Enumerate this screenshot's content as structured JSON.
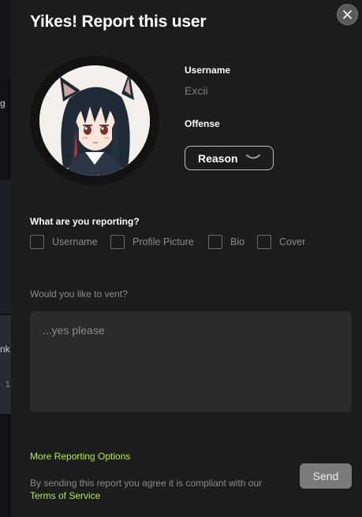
{
  "background": {
    "fragments": [
      "g",
      "nk",
      "· 1"
    ]
  },
  "modal": {
    "title": "Yikes! Report this user",
    "close_icon": "close-icon",
    "avatar_icon": "avatar-anime-cat-girl",
    "username_label": "Username",
    "username_value": "Excii",
    "offense_label": "Offense",
    "reason_select": {
      "value": "Reason",
      "icon": "chevron-down-icon"
    },
    "reporting_question": "What are you reporting?",
    "report_options": [
      {
        "label": "Username",
        "checked": false
      },
      {
        "label": "Profile Picture",
        "checked": false
      },
      {
        "label": "Bio",
        "checked": false
      },
      {
        "label": "Cover",
        "checked": false
      }
    ],
    "vent_label": "Would you like to vent?",
    "vent_placeholder": "...yes please",
    "more_options_link": "More Reporting Options",
    "legal_text": "By sending this report you agree it is compliant with our",
    "tos_link": "Terms of Service",
    "send_label": "Send"
  },
  "colors": {
    "modal_bg": "#1c1c1c",
    "accent_link": "#b5ef3c",
    "send_button": "#7a7a7a",
    "textarea_bg": "#2b2b2b"
  }
}
